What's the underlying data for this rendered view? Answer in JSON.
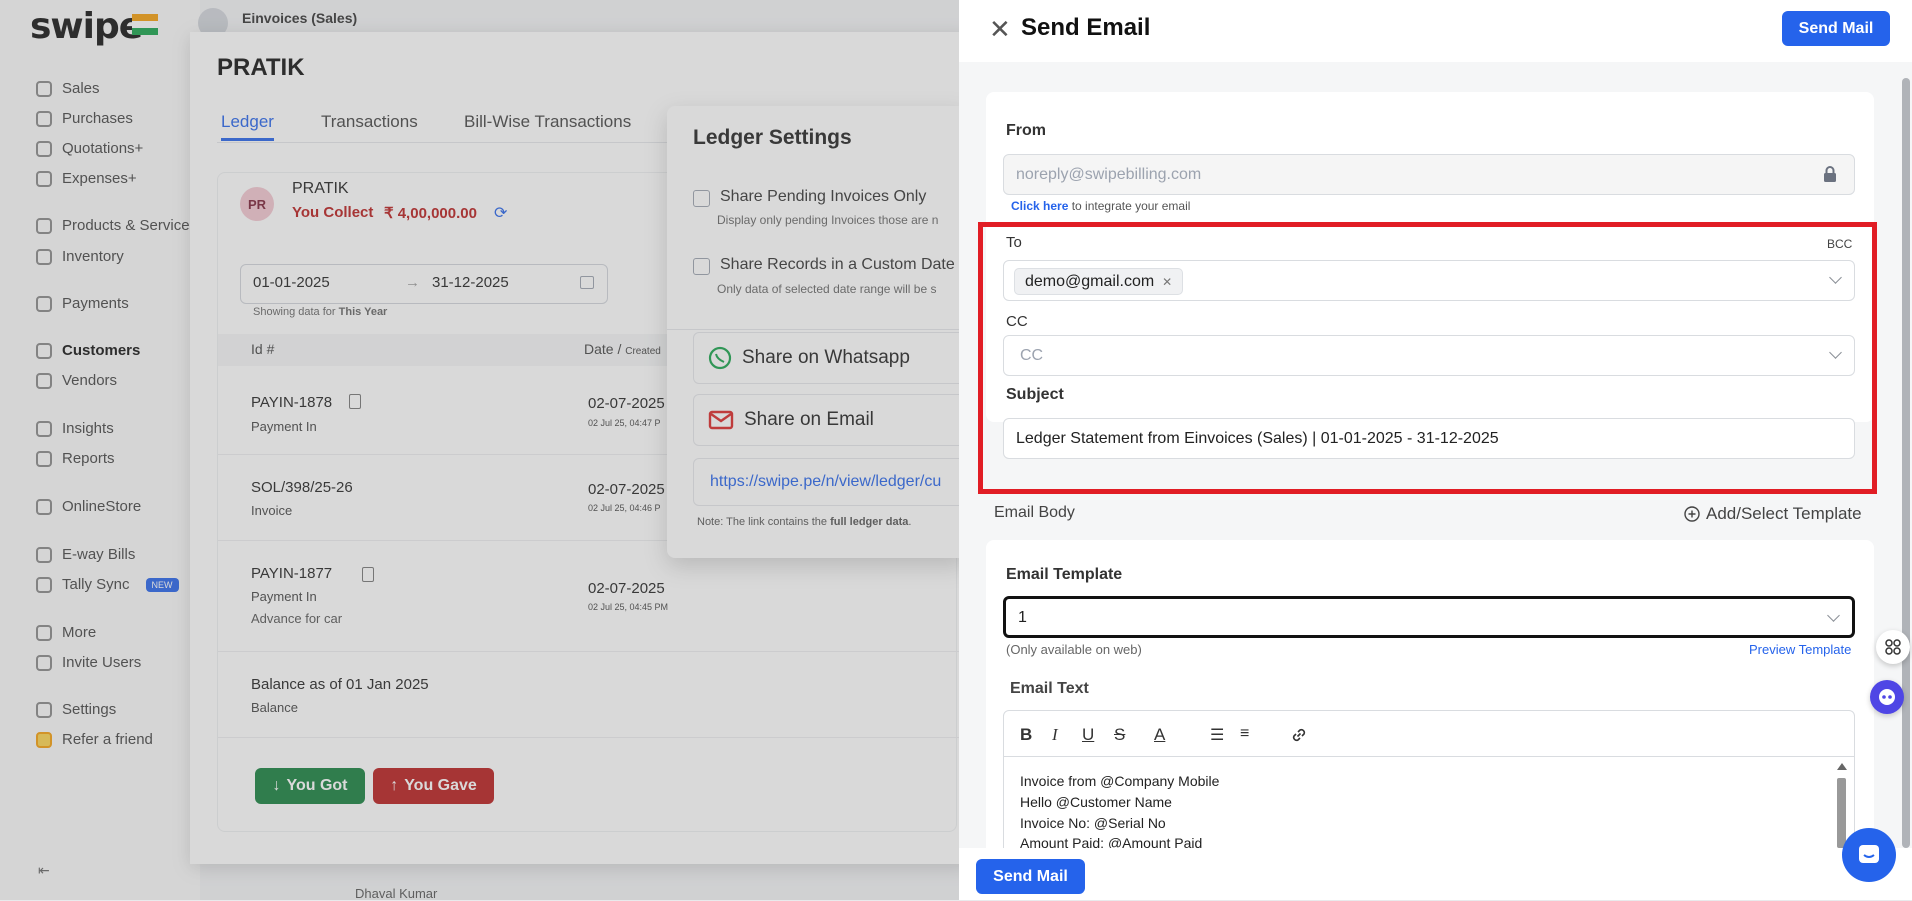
{
  "app": {
    "logo": "swipe",
    "top_title": "Einvoices (Sales)",
    "sidebar": [
      {
        "label": "Sales"
      },
      {
        "label": "Purchases"
      },
      {
        "label": "Quotations+"
      },
      {
        "label": "Expenses+"
      },
      {
        "label": "Products & Services"
      },
      {
        "label": "Inventory"
      },
      {
        "label": "Payments"
      },
      {
        "label": "Customers"
      },
      {
        "label": "Vendors"
      },
      {
        "label": "Insights"
      },
      {
        "label": "Reports"
      },
      {
        "label": "OnlineStore"
      },
      {
        "label": "E-way Bills"
      },
      {
        "label": "Tally Sync",
        "badge": "NEW"
      },
      {
        "label": "More"
      },
      {
        "label": "Invite Users"
      },
      {
        "label": "Settings"
      },
      {
        "label": "Refer a friend"
      }
    ],
    "bottom_row": "Dhaval Kumar"
  },
  "customer": {
    "title": "PRATIK",
    "tabs": [
      "Ledger",
      "Transactions",
      "Bill-Wise Transactions"
    ],
    "initials": "PR",
    "name": "PRATIK",
    "collect_label": "You Collect",
    "collect_amount": "₹ 4,00,000.00",
    "date_from": "01-01-2025",
    "date_arrow": "→",
    "date_to": "31-12-2025",
    "showing_prefix": "Showing data for",
    "showing_period": "This Year",
    "col_id": "Id #",
    "col_date": "Date /",
    "col_date_sub": "Created",
    "rows": [
      {
        "id": "PAYIN-1878",
        "type": "Payment In",
        "date": "02-07-2025",
        "sub": "02 Jul 25, 04:47 P"
      },
      {
        "id": "SOL/398/25-26",
        "type": "Invoice",
        "date": "02-07-2025",
        "sub": "02 Jul 25, 04:46 P"
      },
      {
        "id": "PAYIN-1877",
        "type": "Payment In",
        "note": "Advance for car",
        "date": "02-07-2025",
        "sub": "02 Jul 25, 04:45 PM"
      },
      {
        "id": "Balance as of 01 Jan 2025",
        "type": "Balance"
      }
    ],
    "you_got": "You Got",
    "you_gave": "You Gave"
  },
  "ledger_settings": {
    "title": "Ledger Settings",
    "opt1": "Share Pending Invoices Only",
    "opt1_desc": "Display only pending Invoices those are n",
    "opt2": "Share Records in a Custom Date",
    "opt2_desc": "Only data of selected date range will be s",
    "whatsapp": "Share on Whatsapp",
    "email": "Share on Email",
    "link": "https://swipe.pe/n/view/ledger/cu",
    "note_prefix": "Note: The link contains the",
    "note_bold": "full ledger data",
    "note_suffix": "."
  },
  "drawer": {
    "title": "Send Email",
    "send_mail": "Send Mail",
    "from_label": "From",
    "from_value": "noreply@swipebilling.com",
    "click_here": "Click here",
    "integrate_text": " to integrate your email",
    "to_label": "To",
    "bcc": "BCC",
    "to_tag": "demo@gmail.com",
    "cc_label": "CC",
    "cc_placeholder": "CC",
    "subject_label": "Subject",
    "subject_value": "Ledger Statement from Einvoices (Sales) | 01-01-2025 - 31-12-2025",
    "email_body_label": "Email Body",
    "add_template": "Add/Select Template",
    "template_label": "Email Template",
    "template_value": "1",
    "only_web": "(Only available on web)",
    "preview_template": "Preview Template",
    "email_text_label": "Email Text",
    "body_lines": [
      "Invoice from @Company Mobile",
      "Hello @Customer Name",
      "Invoice No: @Serial No",
      "Amount Paid: @Amount Paid"
    ]
  },
  "colors": {
    "primary": "#2563eb",
    "danger": "#b91c1c",
    "success": "#15803d",
    "highlight": "#e11d25"
  }
}
